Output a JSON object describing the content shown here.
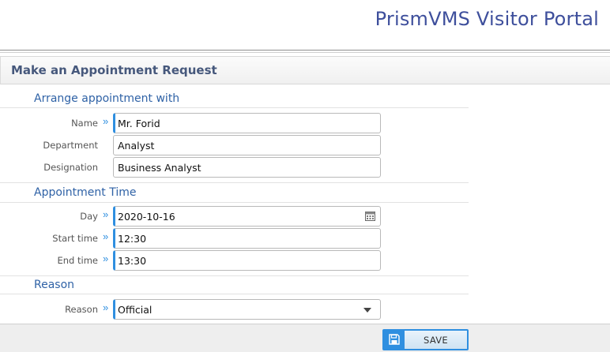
{
  "header": {
    "brand": "PrismVMS Visitor Portal"
  },
  "page": {
    "title": "Make an Appointment Request"
  },
  "sections": {
    "arrange": {
      "title": "Arrange appointment with",
      "name_label": "Name",
      "name_value": "Mr. Forid",
      "department_label": "Department",
      "department_value": "Analyst",
      "designation_label": "Designation",
      "designation_value": "Business Analyst"
    },
    "time": {
      "title": "Appointment Time",
      "day_label": "Day",
      "day_value": "2020-10-16",
      "start_label": "Start time",
      "start_value": "12:30",
      "end_label": "End time",
      "end_value": "13:30"
    },
    "reason": {
      "title": "Reason",
      "reason_label": "Reason",
      "reason_value": "Official"
    }
  },
  "footer": {
    "save_label": "SAVE"
  },
  "icons": {
    "required": "double-chevron-right-icon",
    "calendar": "calendar-icon",
    "dropdown": "caret-down-icon",
    "save": "floppy-disk-icon"
  },
  "colors": {
    "accent": "#2f8fe0",
    "brand": "#3e4f9c",
    "section_title": "#2f62a6"
  }
}
